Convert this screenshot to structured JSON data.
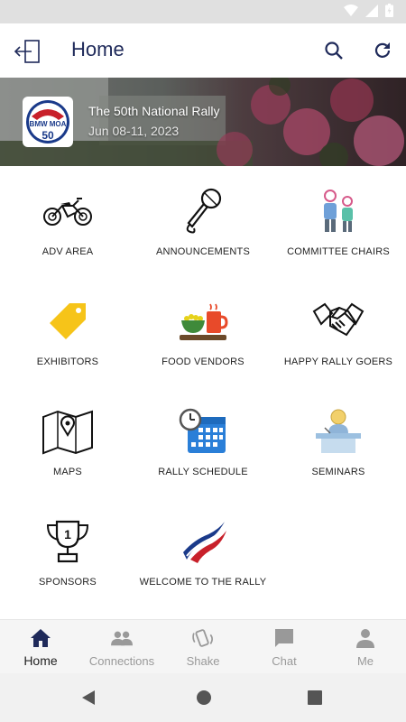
{
  "header": {
    "title": "Home",
    "back_icon": "exit-icon",
    "search_icon": "search-icon",
    "refresh_icon": "refresh-icon"
  },
  "banner": {
    "title": "The 50th National Rally",
    "date": "Jun 08-11, 2023",
    "logo_text": "BMW MOA",
    "logo_number": "50"
  },
  "tiles": [
    {
      "label": "ADV AREA",
      "icon": "motorcycle-icon"
    },
    {
      "label": "ANNOUNCEMENTS",
      "icon": "microphone-icon"
    },
    {
      "label": "COMMITTEE CHAIRS",
      "icon": "people-icon"
    },
    {
      "label": "EXHIBITORS",
      "icon": "tag-icon"
    },
    {
      "label": "FOOD VENDORS",
      "icon": "food-icon"
    },
    {
      "label": "HAPPY RALLY GOERS",
      "icon": "handshake-icon"
    },
    {
      "label": "MAPS",
      "icon": "map-icon"
    },
    {
      "label": "RALLY SCHEDULE",
      "icon": "calendar-icon"
    },
    {
      "label": "SEMINARS",
      "icon": "speaker-podium-icon"
    },
    {
      "label": "SPONSORS",
      "icon": "trophy-icon"
    },
    {
      "label": "WELCOME TO THE RALLY",
      "icon": "flag-stripes-icon"
    }
  ],
  "bottom_nav": [
    {
      "label": "Home",
      "icon": "home-icon",
      "active": true
    },
    {
      "label": "Connections",
      "icon": "connections-icon",
      "active": false
    },
    {
      "label": "Shake",
      "icon": "shake-icon",
      "active": false
    },
    {
      "label": "Chat",
      "icon": "chat-icon",
      "active": false
    },
    {
      "label": "Me",
      "icon": "person-icon",
      "active": false
    }
  ],
  "colors": {
    "title": "#1f2a5a",
    "accent_blue": "#1a3a8a",
    "inactive_nav": "#999999"
  }
}
